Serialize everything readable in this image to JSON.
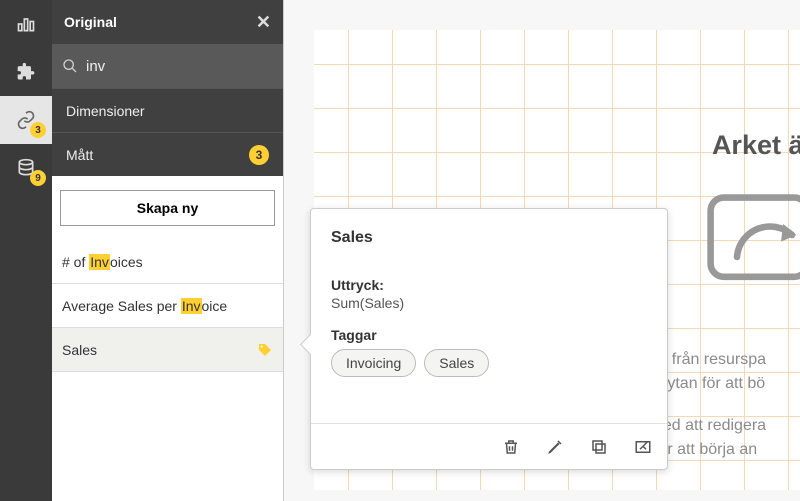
{
  "rail": {
    "charts_label": "charts",
    "extensions_label": "extensions",
    "tags_label": "tags",
    "data_label": "data",
    "badge_tags": "3",
    "badge_data": "9"
  },
  "panel": {
    "title": "Original",
    "search_value": "inv",
    "dimensions_label": "Dimensioner",
    "measures_label": "Mått",
    "measures_count": "3",
    "create_label": "Skapa ny",
    "items": [
      {
        "pre": "# of ",
        "hl": "Inv",
        "post": "oices"
      },
      {
        "pre": "Average Sales per ",
        "hl": "Inv",
        "post": "oice"
      },
      {
        "pre": "Sales",
        "hl": "",
        "post": ""
      }
    ]
  },
  "canvas": {
    "title": "Arket är",
    "line1": "nt från resurspa",
    "line2": "e ytan för att bö",
    "line3": "ned att redigera",
    "line4": "för att börja an"
  },
  "popover": {
    "title": "Sales",
    "expr_label": "Uttryck:",
    "expr_value": "Sum(Sales)",
    "tags_label": "Taggar",
    "tags": [
      "Invoicing",
      "Sales"
    ]
  }
}
